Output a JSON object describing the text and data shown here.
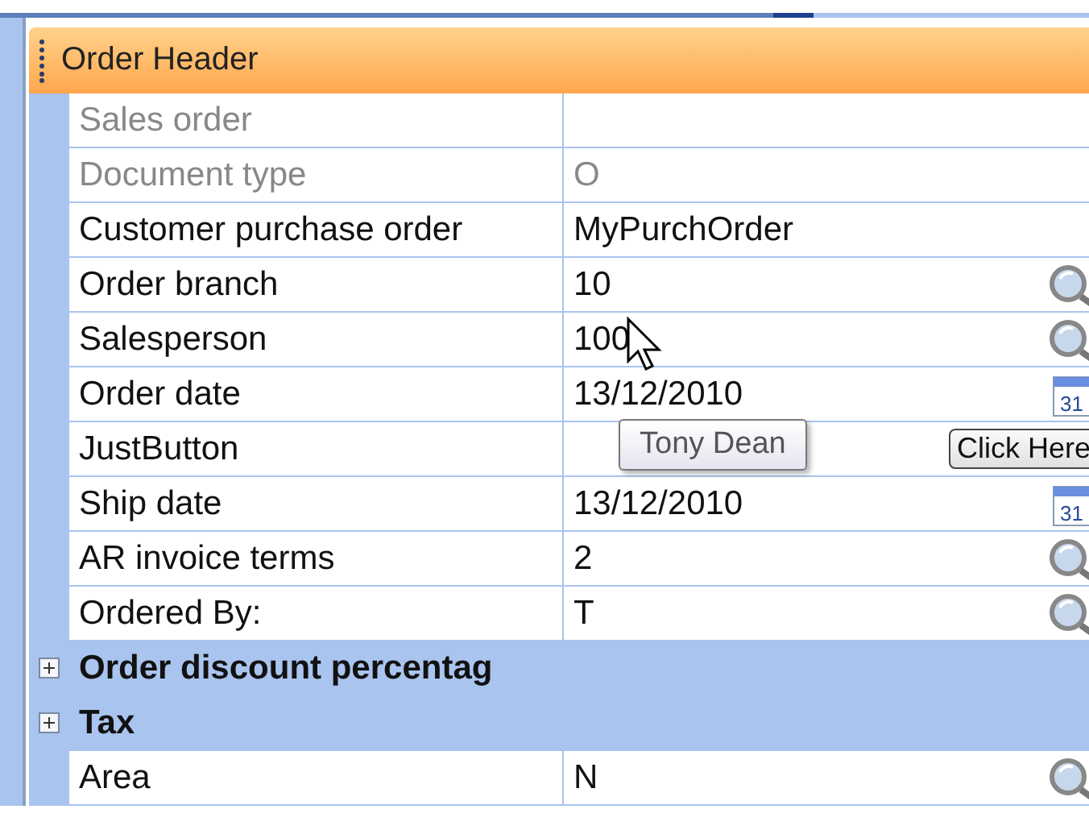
{
  "header": {
    "title": "Order Header"
  },
  "rows": [
    {
      "kind": "text",
      "label": "Sales order",
      "disabled": true
    },
    {
      "kind": "text",
      "label": "Document type",
      "value": "O",
      "disabled": true
    },
    {
      "kind": "text",
      "label": "Customer purchase order",
      "value": "MyPurchOrder",
      "disabled": false
    },
    {
      "kind": "lookup",
      "label": "Order branch",
      "value": "10",
      "disabled": false
    },
    {
      "kind": "lookup",
      "label": "Salesperson",
      "value": "100",
      "disabled": false
    },
    {
      "kind": "calendar",
      "label": "Order date",
      "value": "13/12/2010",
      "disabled": false,
      "icon_label": "31"
    },
    {
      "kind": "button",
      "label": "JustButton",
      "disabled": false,
      "button_label": "Click Here"
    },
    {
      "kind": "calendar",
      "label": "Ship date",
      "value": "13/12/2010",
      "disabled": false,
      "icon_label": "31"
    },
    {
      "kind": "lookup",
      "label": "AR invoice terms",
      "value": "2",
      "disabled": false
    },
    {
      "kind": "lookup",
      "label": "Ordered By:",
      "value": "T",
      "disabled": false
    },
    {
      "kind": "category",
      "label": "Order discount percentag",
      "expanded": false
    },
    {
      "kind": "category",
      "label": "Tax",
      "expanded": false
    },
    {
      "kind": "lookup",
      "label": "Area",
      "value": "N",
      "disabled": false
    }
  ],
  "tooltip": {
    "text": "Tony Dean"
  }
}
